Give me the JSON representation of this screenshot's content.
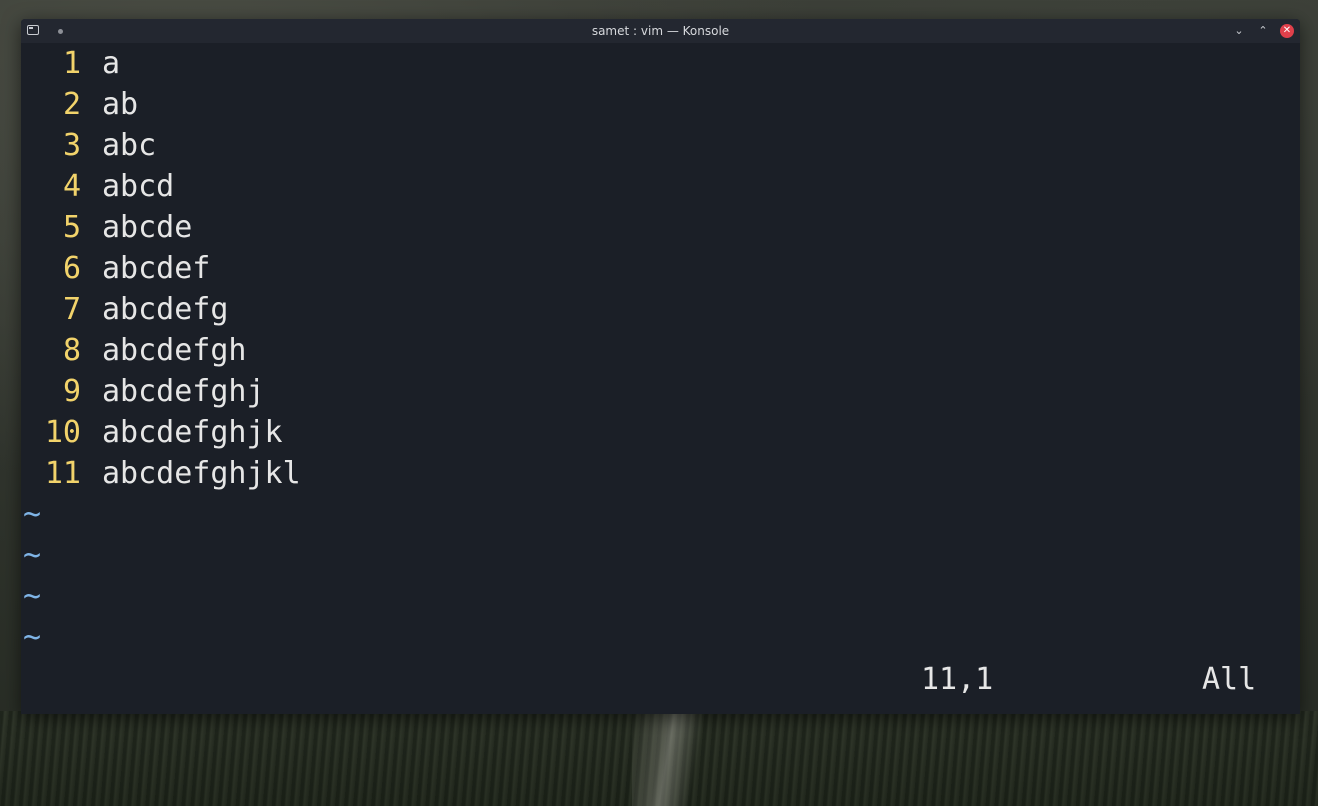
{
  "window": {
    "title": "samet : vim — Konsole",
    "icons": [
      "terminal-app-icon",
      "pin-dot-icon",
      "minimize-icon",
      "maximize-icon",
      "close-icon"
    ]
  },
  "editor": {
    "lines": [
      {
        "num": "1",
        "text": "a"
      },
      {
        "num": "2",
        "text": "ab"
      },
      {
        "num": "3",
        "text": "abc"
      },
      {
        "num": "4",
        "text": "abcd"
      },
      {
        "num": "5",
        "text": "abcde"
      },
      {
        "num": "6",
        "text": "abcdef"
      },
      {
        "num": "7",
        "text": "abcdefg"
      },
      {
        "num": "8",
        "text": "abcdefgh"
      },
      {
        "num": "9",
        "text": "abcdefghj"
      },
      {
        "num": "10",
        "text": "abcdefghjk"
      },
      {
        "num": "11",
        "text": "abcdefghjkl"
      }
    ],
    "empty_line_markers": [
      "~",
      "~",
      "~",
      "~"
    ],
    "status": {
      "position": "11,1",
      "scroll": "All"
    }
  },
  "colors": {
    "line_number": "#f2d36b",
    "tilde": "#7fb4e6",
    "text": "#e6e6e6",
    "background": "#1b1f27",
    "close_button": "#e0404b"
  }
}
